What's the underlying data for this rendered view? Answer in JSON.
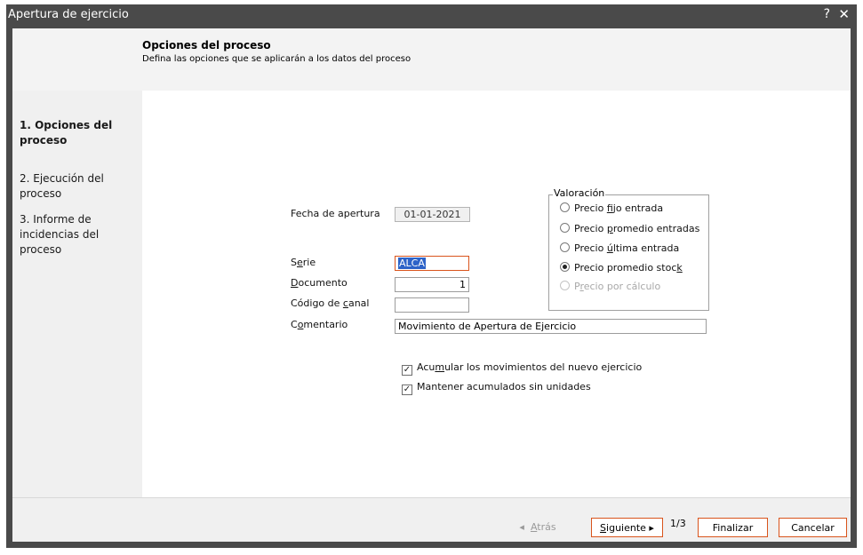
{
  "window": {
    "title": "Apertura de ejercicio",
    "help_glyph": "?",
    "close_glyph": "✕"
  },
  "header": {
    "title": "Opciones del proceso",
    "subtitle": "Defina las opciones que se aplicarán a los datos del proceso"
  },
  "steps": [
    {
      "label": "1. Opciones del proceso",
      "active": true
    },
    {
      "label": "2. Ejecución del proceso",
      "active": false
    },
    {
      "label": "3. Informe de incidencias del proceso",
      "active": false
    }
  ],
  "form": {
    "fecha_label": "Fecha de apertura",
    "fecha_value": "01-01-2021",
    "serie_label_pre": "S",
    "serie_label_ul": "e",
    "serie_label_post": "rie",
    "serie_value": "ALCA",
    "documento_label_pre": "",
    "documento_label_ul": "D",
    "documento_label_post": "ocumento",
    "documento_value": "1",
    "canal_label_pre": "Código de ",
    "canal_label_ul": "c",
    "canal_label_post": "anal",
    "canal_value": "",
    "comentario_label_pre": "C",
    "comentario_label_ul": "o",
    "comentario_label_post": "mentario",
    "comentario_value": "Movimiento de Apertura de Ejercicio"
  },
  "valoracion": {
    "legend": "Valoración",
    "options": [
      {
        "pre": "Precio ",
        "ul": "f",
        "post": "ijo entrada",
        "checked": false,
        "disabled": false
      },
      {
        "pre": "Precio ",
        "ul": "p",
        "post": "romedio entradas",
        "checked": false,
        "disabled": false
      },
      {
        "pre": "Precio ",
        "ul": "ú",
        "post": "ltima entrada",
        "checked": false,
        "disabled": false
      },
      {
        "pre": "Precio promedio stoc",
        "ul": "k",
        "post": "",
        "checked": true,
        "disabled": false
      },
      {
        "pre": "P",
        "ul": "r",
        "post": "ecio por cálculo",
        "checked": false,
        "disabled": true
      }
    ]
  },
  "checks": [
    {
      "pre": "Acu",
      "ul": "m",
      "post": "ular los movimientos del nuevo ejercicio",
      "checked": true
    },
    {
      "pre": "Mantener acumulados sin unidades",
      "ul": "",
      "post": "",
      "checked": true
    }
  ],
  "footer": {
    "back_arrow": "◂",
    "back_pre": "",
    "back_ul": "A",
    "back_post": "trás",
    "next_pre": "",
    "next_ul": "S",
    "next_post": "iguiente",
    "next_arrow": "▸",
    "page": "1/3",
    "finish": "Finalizar",
    "cancel": "Cancelar"
  }
}
